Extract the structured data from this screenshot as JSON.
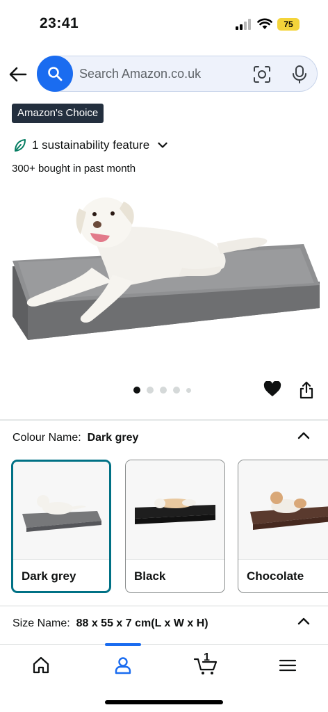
{
  "status_bar": {
    "time": "23:41",
    "battery": "75"
  },
  "search": {
    "placeholder": "Search Amazon.co.uk"
  },
  "badge": {
    "label": "Amazon's Choice"
  },
  "sustainability": {
    "label": "1 sustainability feature"
  },
  "social_proof": {
    "text": "300+ bought in past month"
  },
  "gallery": {
    "image_count": 5,
    "active_index": 0
  },
  "colour": {
    "name_label": "Colour Name:",
    "selected": "Dark grey",
    "options": [
      {
        "label": "Dark grey",
        "color": "#77787a"
      },
      {
        "label": "Black",
        "color": "#1e1e1e"
      },
      {
        "label": "Chocolate",
        "color": "#5a3a2e"
      }
    ]
  },
  "size": {
    "name_label": "Size Name:",
    "selected": "88 x 55 x 7 cm(L x W x H)"
  },
  "bottom_nav": {
    "cart_count": "1",
    "active": "account"
  },
  "colors": {
    "accent": "#1a6cf0",
    "selected_border": "#007185",
    "badge_bg": "#232f3e",
    "battery": "#f4d43a"
  }
}
